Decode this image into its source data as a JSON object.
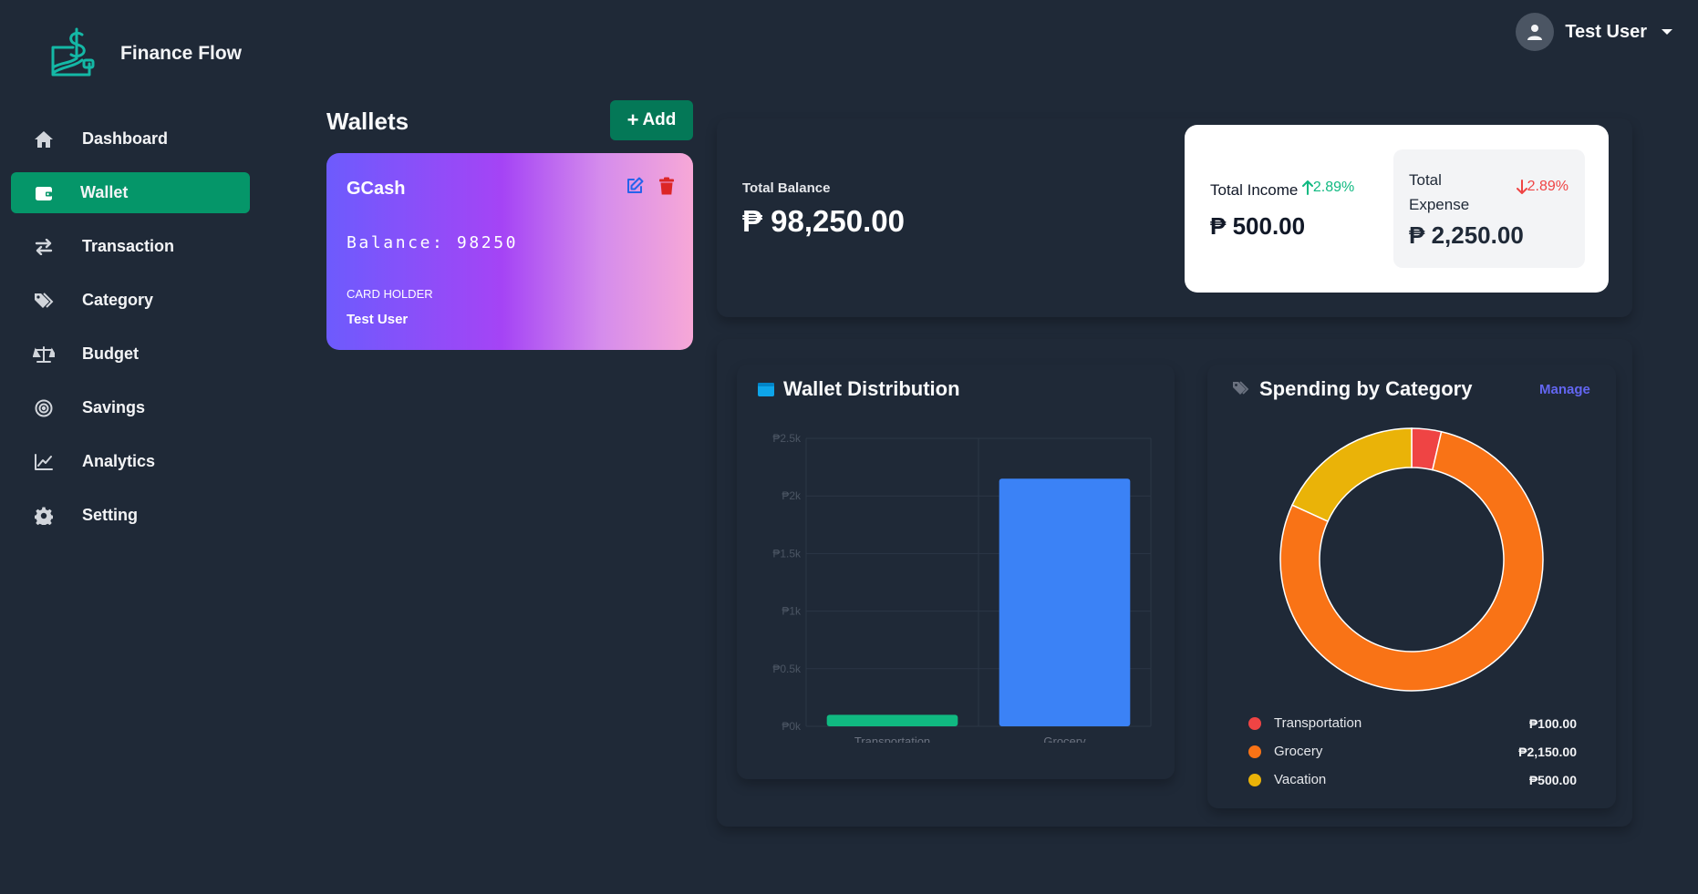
{
  "app": {
    "title": "Finance Flow"
  },
  "user": {
    "name": "Test User"
  },
  "nav": [
    {
      "label": "Dashboard",
      "icon": "home-icon"
    },
    {
      "label": "Wallet",
      "icon": "wallet-icon",
      "active": true
    },
    {
      "label": "Transaction",
      "icon": "transfer-arrows-icon"
    },
    {
      "label": "Category",
      "icon": "tags-icon"
    },
    {
      "label": "Budget",
      "icon": "scale-icon"
    },
    {
      "label": "Savings",
      "icon": "target-icon"
    },
    {
      "label": "Analytics",
      "icon": "chart-line-icon"
    },
    {
      "label": "Setting",
      "icon": "gear-icon"
    }
  ],
  "wallets": {
    "title": "Wallets",
    "add_label": "Add",
    "card": {
      "name": "GCash",
      "balance": "Balance: 98250",
      "holder_label": "CARD HOLDER",
      "holder": "Test User"
    }
  },
  "summary": {
    "total_balance_label": "Total Balance",
    "total_balance": "₱ 98,250.00",
    "income_label": "Total Income",
    "income_pct": "2.89%",
    "income_value": "₱ 500.00",
    "expense_label": "Total Expense",
    "expense_pct": "2.89%",
    "expense_value": "₱ 2,250.00"
  },
  "wallet_distribution": {
    "title": "Wallet Distribution"
  },
  "spending": {
    "title": "Spending by Category",
    "manage_label": "Manage",
    "legend": [
      {
        "name": "Transportation",
        "value": "₱100.00",
        "color": "#ef4444"
      },
      {
        "name": "Grocery",
        "value": "₱2,150.00",
        "color": "#f97316"
      },
      {
        "name": "Vacation",
        "value": "₱500.00",
        "color": "#eab308"
      }
    ]
  },
  "colors": {
    "accent": "#059669",
    "bar_green": "#10b981",
    "bar_blue": "#3b82f6"
  },
  "chart_data": [
    {
      "type": "bar",
      "title": "Wallet Distribution",
      "categories": [
        "Transportation",
        "Grocery"
      ],
      "values": [
        100,
        2150
      ],
      "colors": [
        "#10b981",
        "#3b82f6"
      ],
      "ylim": [
        0,
        2500
      ],
      "yticks": [
        "₱0k",
        "₱0.5k",
        "₱1k",
        "₱1.5k",
        "₱2k",
        "₱2.5k"
      ],
      "grid": true
    },
    {
      "type": "pie",
      "title": "Spending by Category",
      "categories": [
        "Transportation",
        "Grocery",
        "Vacation"
      ],
      "values": [
        100,
        2150,
        500
      ],
      "colors": [
        "#ef4444",
        "#f97316",
        "#eab308"
      ]
    }
  ]
}
